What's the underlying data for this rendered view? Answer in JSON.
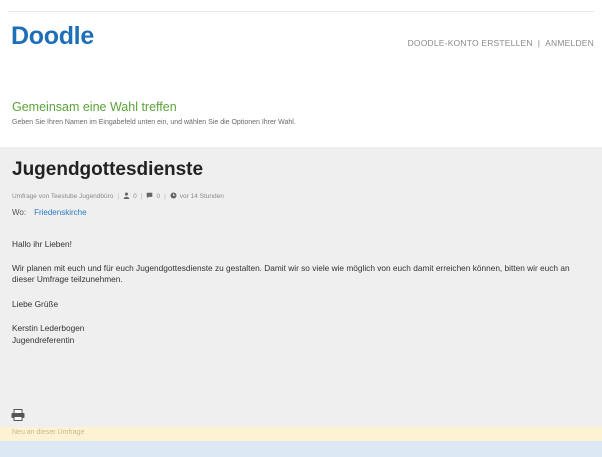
{
  "header": {
    "logo": "Doodle",
    "nav": {
      "create_account": "DOODLE-KONTO ERSTELLEN",
      "separator": "|",
      "login": "ANMELDEN"
    }
  },
  "intro": {
    "title": "Gemeinsam eine Wahl treffen",
    "subtitle": "Geben Sie Ihren Namen im Eingabefeld unten ein, und wählen Sie die Optionen Ihrer Wahl."
  },
  "poll": {
    "title": "Jugendgottesdienste",
    "meta": {
      "author": "Umfrage von Teestube Jugendbüro",
      "participants": "0",
      "comments": "0",
      "age": "vor 14 Stunden",
      "separator": "|"
    },
    "location_label": "Wo:",
    "location": "Friedenskirche",
    "description": {
      "greeting": "Hallo ihr Lieben!",
      "body": "Wir planen mit euch und für euch Jugendgottesdienste zu gestalten. Damit wir so viele wie möglich von euch damit erreichen können, bitten wir euch an dieser Umfrage teilzunehmen.",
      "closing": "Liebe Grüße",
      "name": "Kerstin Lederbogen",
      "role": "Jugendreferentin"
    }
  },
  "footer_strip": {
    "text": "Neu an dieser Umfrage"
  },
  "icons": {
    "participants": "person-icon",
    "comments": "comment-icon",
    "age": "clock-icon",
    "print": "print-icon"
  },
  "colors": {
    "brand": "#1e6fb8",
    "intro_title": "#5aa33a",
    "link": "#2a7bc4",
    "panel_bg": "#efefef",
    "notice_bg": "#fbf3d4",
    "bottom_bg": "#dce8f4"
  }
}
